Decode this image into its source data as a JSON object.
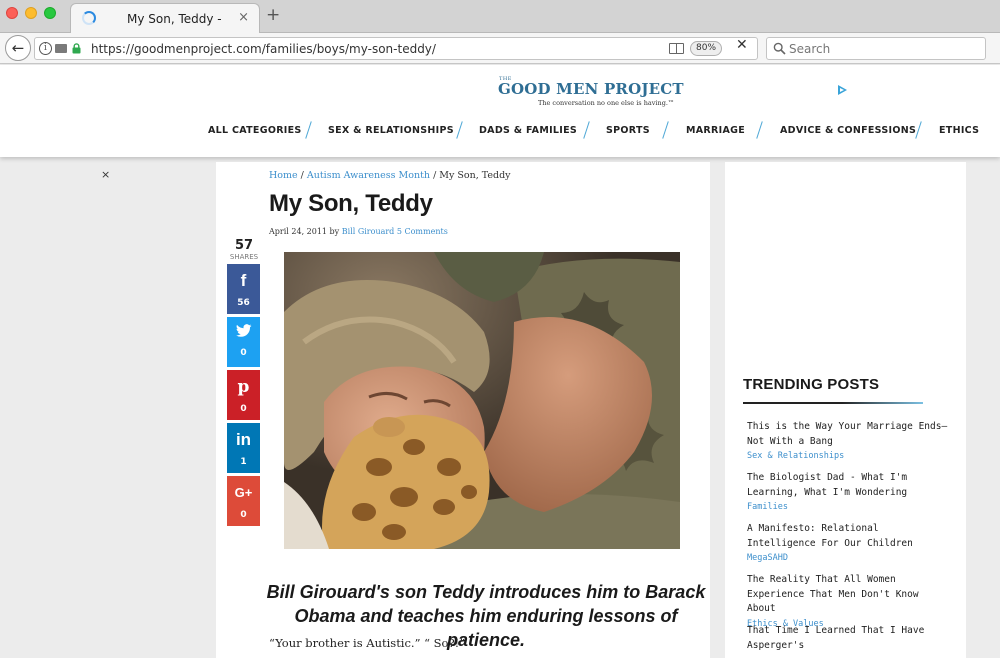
{
  "browser": {
    "tab_title": "My Son, Teddy -",
    "tab_close": "×",
    "new_tab": "+",
    "url": "https://goodmenproject.com/families/boys/my-son-teddy/",
    "zoom": "80%",
    "stop": "✕",
    "search_placeholder": "Search",
    "back_glyph": "←",
    "info_glyph": "i"
  },
  "site": {
    "logo_the": "THE",
    "logo_name": "GOOD MEN PROJECT",
    "logo_tagline": "The conversation no one else is having.™",
    "nav": [
      "ALL CATEGORIES",
      "SEX & RELATIONSHIPS",
      "DADS & FAMILIES",
      "SPORTS",
      "MARRIAGE",
      "ADVICE & CONFESSIONS",
      "ETHICS"
    ],
    "ad_close": "×"
  },
  "article": {
    "breadcrumb_home": "Home",
    "breadcrumb_sep1": " / ",
    "breadcrumb_section": "Autism Awareness Month",
    "breadcrumb_sep2": " / ",
    "breadcrumb_current": "My Son, Teddy",
    "title": "My Son, Teddy",
    "date": "April 24, 2011",
    "by": " by ",
    "author": "Bill Girouard",
    "comments": " 5 Comments",
    "dek": "Bill Girouard's son Teddy introduces him to Barack Obama and teaches him enduring lessons of patience.",
    "first_line": "“Your brother is Autistic.” “ So?!”"
  },
  "share": {
    "total": "57",
    "label": "SHARES",
    "facebook": {
      "icon": "f",
      "count": "56"
    },
    "twitter": {
      "icon": "t",
      "count": "0"
    },
    "pinterest": {
      "icon": "p",
      "count": "0"
    },
    "linkedin": {
      "icon": "in",
      "count": "1"
    },
    "googleplus": {
      "icon": "G+",
      "count": "0"
    }
  },
  "sidebar": {
    "heading": "TRENDING POSTS",
    "items": [
      {
        "title": "This is the Way Your Marriage Ends—Not With a Bang",
        "category": "Sex & Relationships"
      },
      {
        "title": "The Biologist Dad - What I'm Learning, What I'm Wondering",
        "category": "Families"
      },
      {
        "title": "A Manifesto: Relational Intelligence For Our Children",
        "category": "MegaSAHD"
      },
      {
        "title": "The Reality That All Women Experience That Men Don't Know About",
        "category": "Ethics & Values"
      },
      {
        "title": "That Time I Learned That I Have Asperger's",
        "category": ""
      }
    ]
  },
  "colors": {
    "brand_blue": "#2f6e94",
    "link_blue": "#3d8fcc",
    "facebook": "#3b5998",
    "twitter": "#1da1f2",
    "pinterest": "#cb2027",
    "linkedin": "#0077b5",
    "googleplus": "#dd4b39"
  }
}
